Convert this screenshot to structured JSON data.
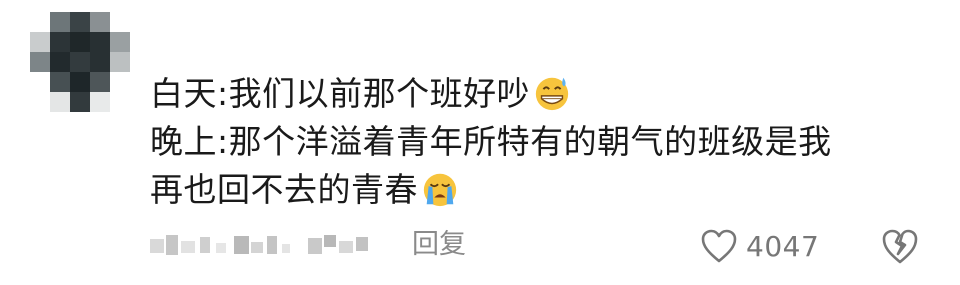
{
  "comment": {
    "lines": [
      "白天:我们以前那个班好吵",
      "晚上:那个洋溢着青年所特有的朝气的班级是我",
      "再也回不去的青春"
    ],
    "emoji_line1": "grinning-sweat-emoji",
    "emoji_line3": "loudly-crying-emoji"
  },
  "footer": {
    "reply_label": "回复",
    "like_count": "4047",
    "like_icon": "heart-outline-icon",
    "dislike_icon": "broken-heart-icon"
  },
  "colors": {
    "text": "#1a1a1a",
    "muted": "#8a8a8a",
    "icon": "#777777"
  }
}
